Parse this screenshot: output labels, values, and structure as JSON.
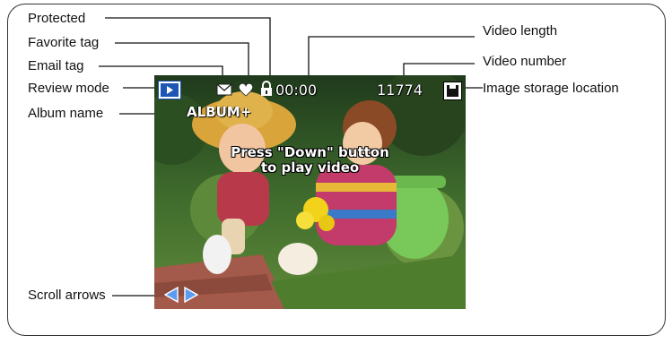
{
  "callouts": {
    "protected": "Protected",
    "favorite_tag": "Favorite tag",
    "email_tag": "Email tag",
    "review_mode": "Review mode",
    "album_name": "Album name",
    "scroll_arrows": "Scroll arrows",
    "video_length": "Video length",
    "video_number": "Video number",
    "image_storage_location": "Image storage location"
  },
  "screen": {
    "time": "00:00",
    "number": "11774",
    "album": "ALBUM+",
    "message_line1": "Press \"Down\" button",
    "message_line2": "to play video"
  },
  "colors": {
    "accent": "#1e56b5",
    "arrow": "#5b9cf0"
  },
  "icons": [
    "review-mode-icon",
    "email-icon",
    "heart-icon",
    "lock-icon",
    "storage-icon",
    "left-arrow-icon",
    "right-arrow-icon"
  ]
}
